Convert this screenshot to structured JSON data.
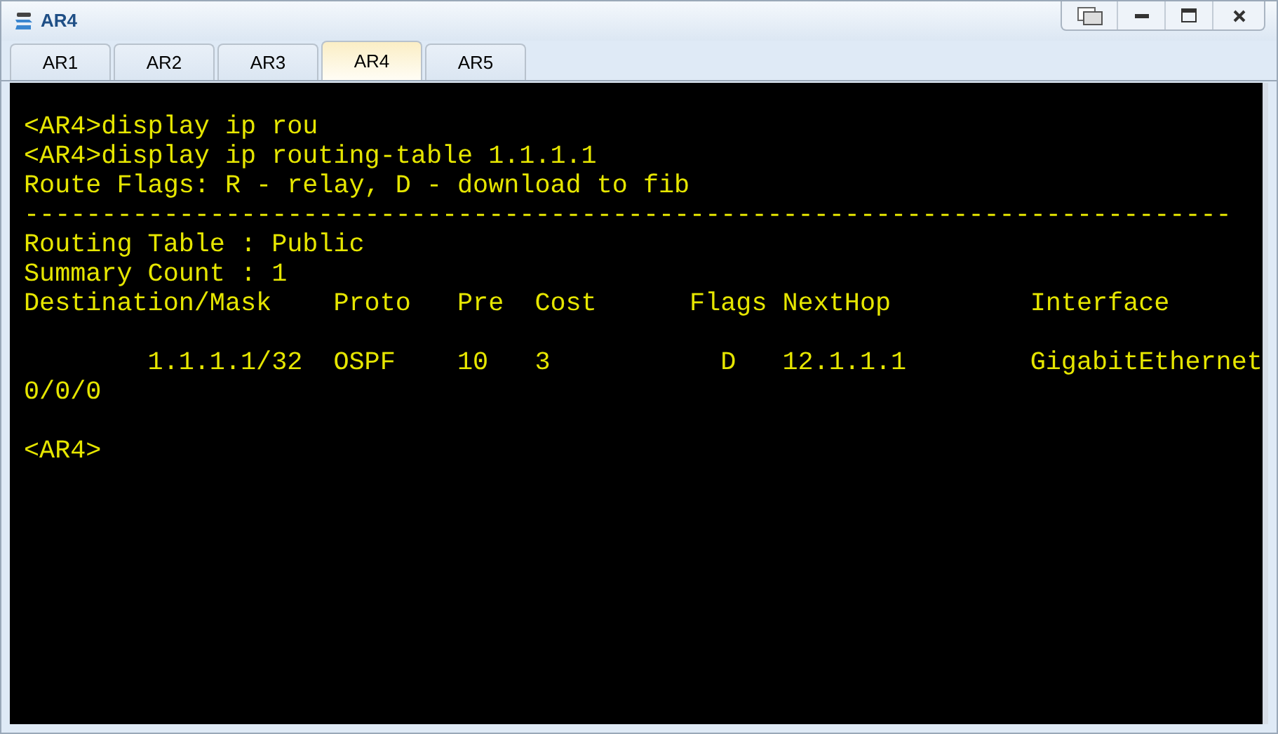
{
  "window": {
    "title": "AR4"
  },
  "tabs": [
    {
      "label": "AR1",
      "selected": false
    },
    {
      "label": "AR2",
      "selected": false
    },
    {
      "label": "AR3",
      "selected": false
    },
    {
      "label": "AR4",
      "selected": true
    },
    {
      "label": "AR5",
      "selected": false
    }
  ],
  "terminal": {
    "blocks": [
      [
        "<AR4>display ip rou",
        "<AR4>display ip routing-table 1.1.1.1",
        "Route Flags: R - relay, D - download to fib",
        "------------------------------------------------------------------------------",
        "Routing Table : Public",
        "Summary Count : 1",
        "Destination/Mask    Proto   Pre  Cost      Flags NextHop         Interface"
      ],
      [
        "        1.1.1.1/32  OSPF    10   3           D   12.1.1.1        GigabitEthernet",
        "0/0/0"
      ],
      [
        "<AR4>"
      ]
    ]
  }
}
